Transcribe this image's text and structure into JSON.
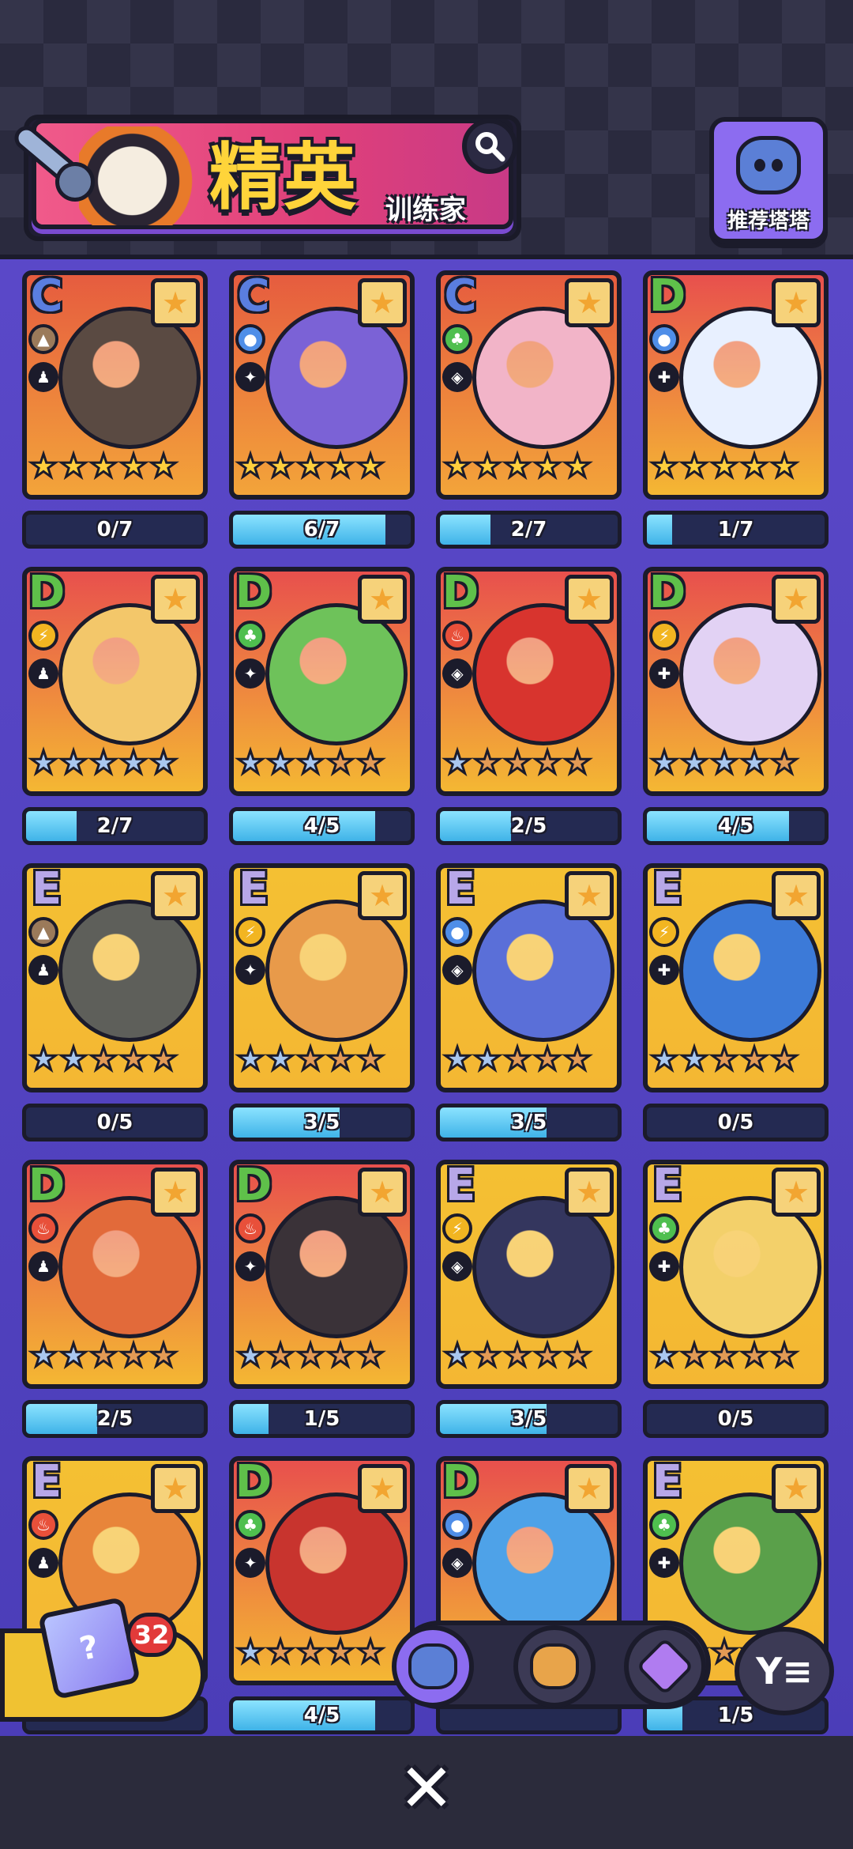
{
  "header": {
    "title_main": "精英",
    "title_sub": "训练家",
    "recommend_label": "推荐塔塔",
    "accent_color": "#e0407a"
  },
  "cards": [
    {
      "tier": "C",
      "element": "earth",
      "elem_color": "#9b7a5a",
      "progress": "0/7",
      "fill": 0.0,
      "body": "#5a4a42",
      "stars": [
        "gold",
        "gold",
        "gold",
        "gold",
        "gold"
      ]
    },
    {
      "tier": "C",
      "element": "water",
      "elem_color": "#4f8ee8",
      "progress": "6/7",
      "fill": 0.857,
      "body": "#7b62d6",
      "stars": [
        "gold",
        "gold",
        "gold",
        "gold",
        "gold"
      ]
    },
    {
      "tier": "C",
      "element": "grass",
      "elem_color": "#4fbf4f",
      "progress": "2/7",
      "fill": 0.286,
      "body": "#f2b4c8",
      "stars": [
        "gold",
        "gold",
        "gold",
        "gold",
        "gold"
      ]
    },
    {
      "tier": "D",
      "element": "water",
      "elem_color": "#4f8ee8",
      "progress": "1/7",
      "fill": 0.143,
      "body": "#e8f0ff",
      "stars": [
        "gold",
        "gold",
        "gold",
        "gold",
        "gold"
      ]
    },
    {
      "tier": "D",
      "element": "electric",
      "elem_color": "#f2b521",
      "progress": "2/7",
      "fill": 0.286,
      "body": "#f3c76a",
      "stars": [
        "blue",
        "blue",
        "blue",
        "blue",
        "blue"
      ]
    },
    {
      "tier": "D",
      "element": "grass",
      "elem_color": "#4fbf4f",
      "progress": "4/5",
      "fill": 0.8,
      "body": "#6ec25a",
      "stars": [
        "blue",
        "blue",
        "blue",
        "bronze",
        "bronze"
      ]
    },
    {
      "tier": "D",
      "element": "fire",
      "elem_color": "#e8503a",
      "progress": "2/5",
      "fill": 0.4,
      "body": "#d8342e",
      "stars": [
        "blue",
        "bronze",
        "bronze",
        "bronze",
        "bronze"
      ]
    },
    {
      "tier": "D",
      "element": "electric",
      "elem_color": "#f2b521",
      "progress": "4/5",
      "fill": 0.8,
      "body": "#e2d2f4",
      "stars": [
        "blue",
        "blue",
        "blue",
        "blue",
        "bronze"
      ]
    },
    {
      "tier": "E",
      "element": "earth",
      "elem_color": "#9b7a5a",
      "progress": "0/5",
      "fill": 0.0,
      "body": "#5e5f5a",
      "stars": [
        "blue",
        "blue",
        "bronze",
        "bronze",
        "bronze"
      ]
    },
    {
      "tier": "E",
      "element": "electric",
      "elem_color": "#f2b521",
      "progress": "3/5",
      "fill": 0.6,
      "body": "#e89a4a",
      "stars": [
        "blue",
        "blue",
        "bronze",
        "bronze",
        "bronze"
      ]
    },
    {
      "tier": "E",
      "element": "water",
      "elem_color": "#4f8ee8",
      "progress": "3/5",
      "fill": 0.6,
      "body": "#5a6fd8",
      "stars": [
        "blue",
        "blue",
        "bronze",
        "bronze",
        "bronze"
      ]
    },
    {
      "tier": "E",
      "element": "electric",
      "elem_color": "#f2b521",
      "progress": "0/5",
      "fill": 0.0,
      "body": "#3c7ad8",
      "stars": [
        "blue",
        "blue",
        "bronze",
        "bronze",
        "bronze"
      ]
    },
    {
      "tier": "D",
      "element": "fire",
      "elem_color": "#e8503a",
      "progress": "2/5",
      "fill": 0.4,
      "body": "#e26a3a",
      "stars": [
        "blue",
        "blue",
        "bronze",
        "bronze",
        "bronze"
      ]
    },
    {
      "tier": "D",
      "element": "fire",
      "elem_color": "#e8503a",
      "progress": "1/5",
      "fill": 0.2,
      "body": "#3a3238",
      "stars": [
        "blue",
        "bronze",
        "bronze",
        "bronze",
        "bronze"
      ]
    },
    {
      "tier": "E",
      "element": "electric",
      "elem_color": "#f2b521",
      "progress": "3/5",
      "fill": 0.6,
      "body": "#34365e",
      "stars": [
        "blue",
        "bronze",
        "bronze",
        "bronze",
        "bronze"
      ]
    },
    {
      "tier": "E",
      "element": "grass",
      "elem_color": "#4fbf4f",
      "progress": "0/5",
      "fill": 0.0,
      "body": "#f3d06a",
      "stars": [
        "blue",
        "bronze",
        "bronze",
        "bronze",
        "bronze"
      ]
    },
    {
      "tier": "E",
      "element": "fire",
      "elem_color": "#e8503a",
      "progress": "",
      "fill": 0.0,
      "body": "#e8853a",
      "stars": [
        "blue",
        "bronze",
        "bronze",
        "bronze",
        "bronze"
      ]
    },
    {
      "tier": "D",
      "element": "grass",
      "elem_color": "#4fbf4f",
      "progress": "4/5",
      "fill": 0.8,
      "body": "#c8342e",
      "stars": [
        "blue",
        "bronze",
        "bronze",
        "bronze",
        "bronze"
      ]
    },
    {
      "tier": "D",
      "element": "water",
      "elem_color": "#4f8ee8",
      "progress": "",
      "fill": 0.0,
      "body": "#4ea2e8",
      "stars": [
        "blue",
        "bronze",
        "bronze",
        "bronze",
        "bronze"
      ]
    },
    {
      "tier": "E",
      "element": "grass",
      "elem_color": "#4fbf4f",
      "progress": "1/5",
      "fill": 0.2,
      "body": "#5aa04a",
      "stars": [
        "blue",
        "bronze",
        "bronze",
        "bronze",
        "bronze"
      ]
    }
  ],
  "bottom": {
    "box_count": "32",
    "box_icon": "?",
    "close_icon": "✕",
    "sort_icon": "Y≡"
  }
}
